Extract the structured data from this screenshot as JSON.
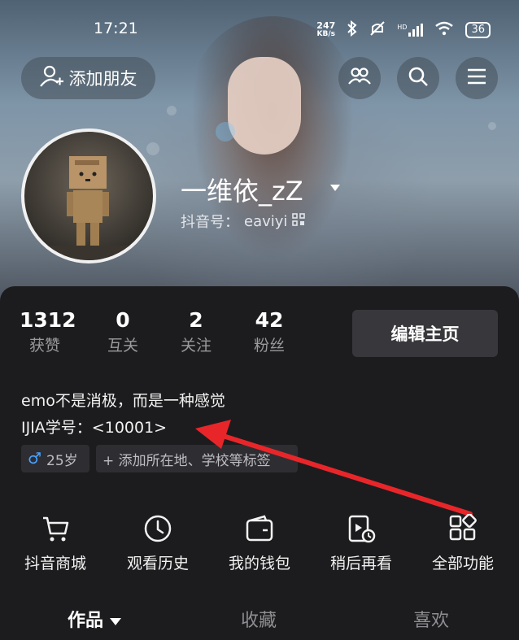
{
  "status_bar": {
    "time": "17:21",
    "net_speed_top": "247",
    "net_speed_unit": "KB/s",
    "network_tag": "HD",
    "battery": "36"
  },
  "header": {
    "add_friend_label": "添加朋友",
    "icons": [
      "friends-icon",
      "search-icon",
      "menu-icon"
    ]
  },
  "profile": {
    "username": "一维依_zZ",
    "douyin_id_label": "抖音号：",
    "douyin_id": "eaviyi"
  },
  "stats": [
    {
      "value": "1312",
      "label": "获赞"
    },
    {
      "value": "0",
      "label": "互关"
    },
    {
      "value": "2",
      "label": "关注"
    },
    {
      "value": "42",
      "label": "粉丝"
    }
  ],
  "edit_profile_label": "编辑主页",
  "bio": {
    "line1": "emo不是消极，而是一种感觉",
    "line2": "IJIA学号：<10001>"
  },
  "tags": {
    "gender_symbol": "♂",
    "age": "25岁",
    "add_location": "+ 添加所在地、学校等标签"
  },
  "shortcuts": [
    {
      "label": "抖音商城",
      "icon": "cart-icon"
    },
    {
      "label": "观看历史",
      "icon": "clock-icon"
    },
    {
      "label": "我的钱包",
      "icon": "wallet-icon"
    },
    {
      "label": "稍后再看",
      "icon": "watch-later-icon"
    },
    {
      "label": "全部功能",
      "icon": "grid-icon"
    }
  ],
  "tabs": [
    {
      "label": "作品"
    },
    {
      "label": "收藏"
    },
    {
      "label": "喜欢"
    }
  ],
  "colors": {
    "panel_bg": "#1c1c1e",
    "annotation_arrow": "#e8262a",
    "male_blue": "#4aa3ff"
  }
}
